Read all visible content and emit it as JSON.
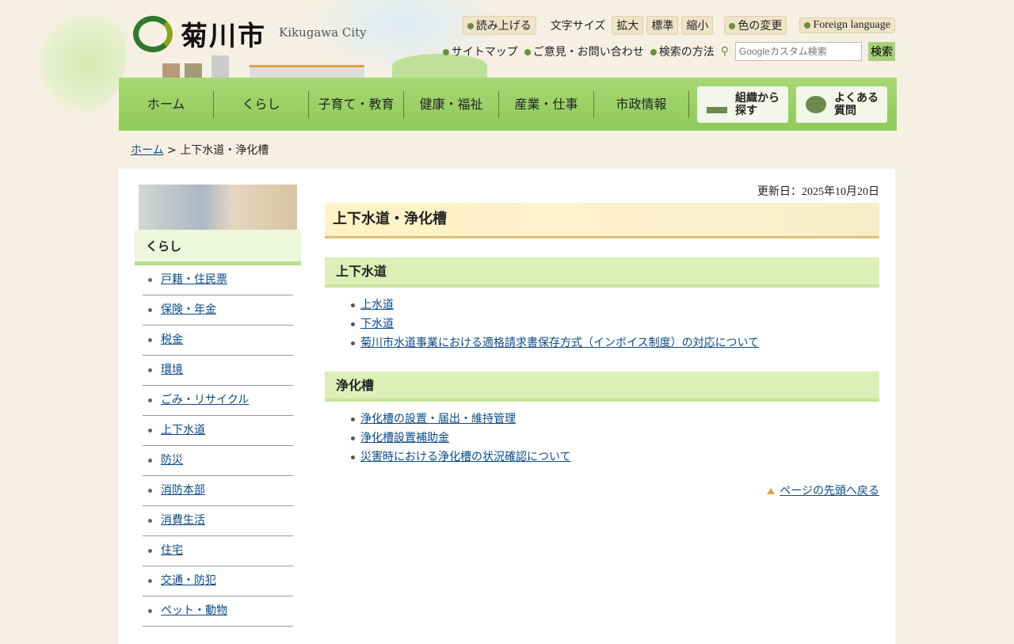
{
  "header": {
    "logo": "菊川市",
    "logo_en": "Kikugawa City",
    "read_aloud": "読み上げる",
    "font_size_label": "文字サイズ",
    "font_large": "拡大",
    "font_normal": "標準",
    "font_small": "縮小",
    "color_change": "色の変更",
    "foreign": "Foreign language",
    "sitemap": "サイトマップ",
    "feedback": "ご意見・お問い合わせ",
    "search_help": "検索の方法",
    "search_placeholder": "Googleカスタム検索",
    "search_button": "検索"
  },
  "nav": {
    "items": [
      "ホーム",
      "くらし",
      "子育て・教育",
      "健康・福祉",
      "産業・仕事",
      "市政情報"
    ],
    "org": "組織から探す",
    "faq": "よくある質問"
  },
  "breadcrumb": {
    "home": "ホーム",
    "sep": " > ",
    "current": "上下水道・浄化槽"
  },
  "sidebar": {
    "title": "くらし",
    "items": [
      "戸籍・住民票",
      "保険・年金",
      "税金",
      "環境",
      "ごみ・リサイクル",
      "上下水道",
      "防災",
      "消防本部",
      "消費生活",
      "住宅",
      "交通・防犯",
      "ペット・動物"
    ]
  },
  "content": {
    "updated": "更新日：2025年10月20日",
    "title": "上下水道・浄化槽",
    "sections": [
      {
        "heading": "上下水道",
        "links": [
          "上水道",
          "下水道",
          "菊川市水道事業における適格請求書保存方式（インボイス制度）の対応について"
        ]
      },
      {
        "heading": "浄化槽",
        "links": [
          "浄化槽の設置・届出・維持管理",
          "浄化槽設置補助金",
          "災害時における浄化槽の状況確認について"
        ]
      }
    ],
    "page_top": "ページの先頭へ戻る"
  }
}
